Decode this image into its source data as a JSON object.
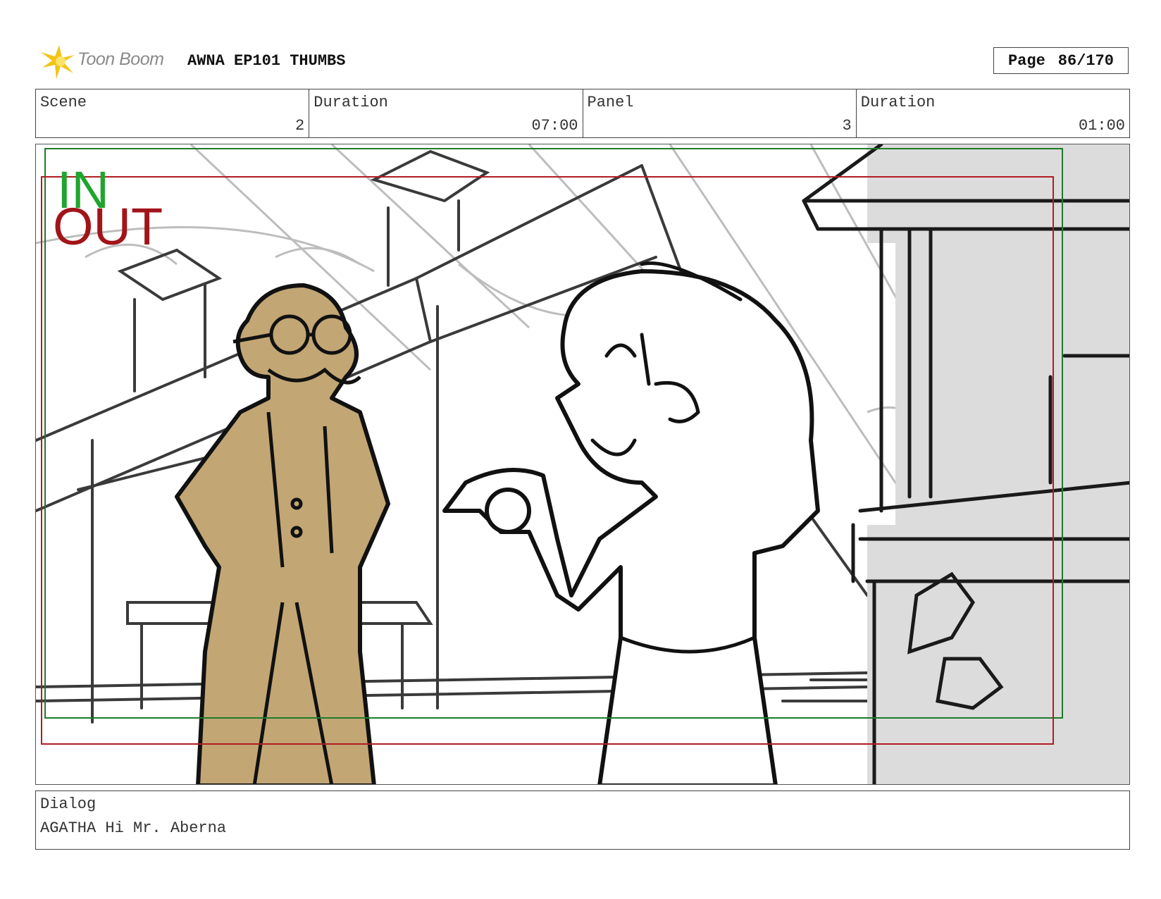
{
  "header": {
    "logo_text": "Toon Boom",
    "project_title": "AWNA EP101 THUMBS",
    "page_label": "Page",
    "page_value": "86/170"
  },
  "info": {
    "scene_label": "Scene",
    "scene_value": "2",
    "scene_duration_label": "Duration",
    "scene_duration_value": "07:00",
    "panel_label": "Panel",
    "panel_value": "3",
    "panel_duration_label": "Duration",
    "panel_duration_value": "01:00"
  },
  "panel": {
    "in_label": "IN",
    "out_label": "OUT",
    "colors": {
      "in_frame": "#1f7a2a",
      "out_frame": "#b01c22",
      "character_fill": "#c2a674",
      "stand_fill": "#dcdcdc"
    }
  },
  "dialog": {
    "label": "Dialog",
    "text": "AGATHA Hi Mr. Aberna"
  }
}
